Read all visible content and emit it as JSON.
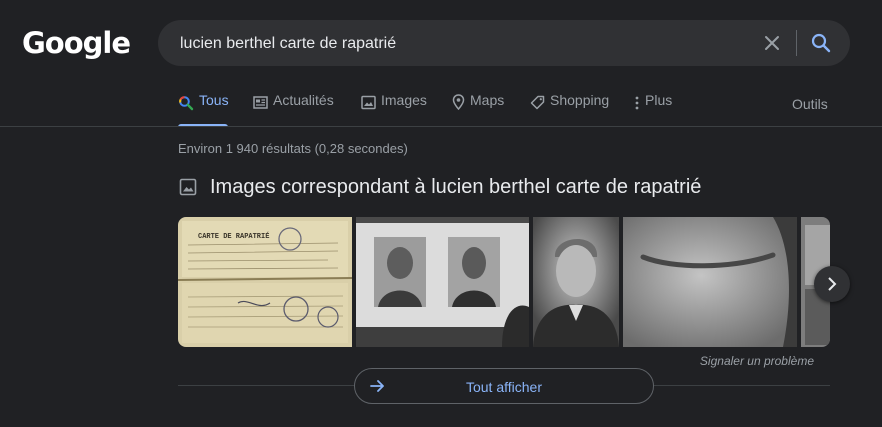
{
  "logo": "Google",
  "search": {
    "query": "lucien berthel carte de rapatrié"
  },
  "tabs": [
    {
      "label": "Tous",
      "active": true,
      "icon": "search-icon"
    },
    {
      "label": "Actualités",
      "icon": "news-icon"
    },
    {
      "label": "Images",
      "icon": "image-icon"
    },
    {
      "label": "Maps",
      "icon": "map-pin-icon"
    },
    {
      "label": "Shopping",
      "icon": "tag-icon"
    },
    {
      "label": "Plus",
      "icon": "more-vert-icon"
    }
  ],
  "tools_label": "Outils",
  "result_stats": "Environ 1 940 résultats (0,28 secondes)",
  "images_section": {
    "title": "Images correspondant à lucien berthel carte de rapatrié",
    "card_text": "CARTE DE RAPATRIÉ",
    "report_label": "Signaler un problème",
    "show_all_label": "Tout afficher"
  },
  "colors": {
    "background": "#202124",
    "accent": "#8ab4f8",
    "search_bg": "#303134"
  }
}
